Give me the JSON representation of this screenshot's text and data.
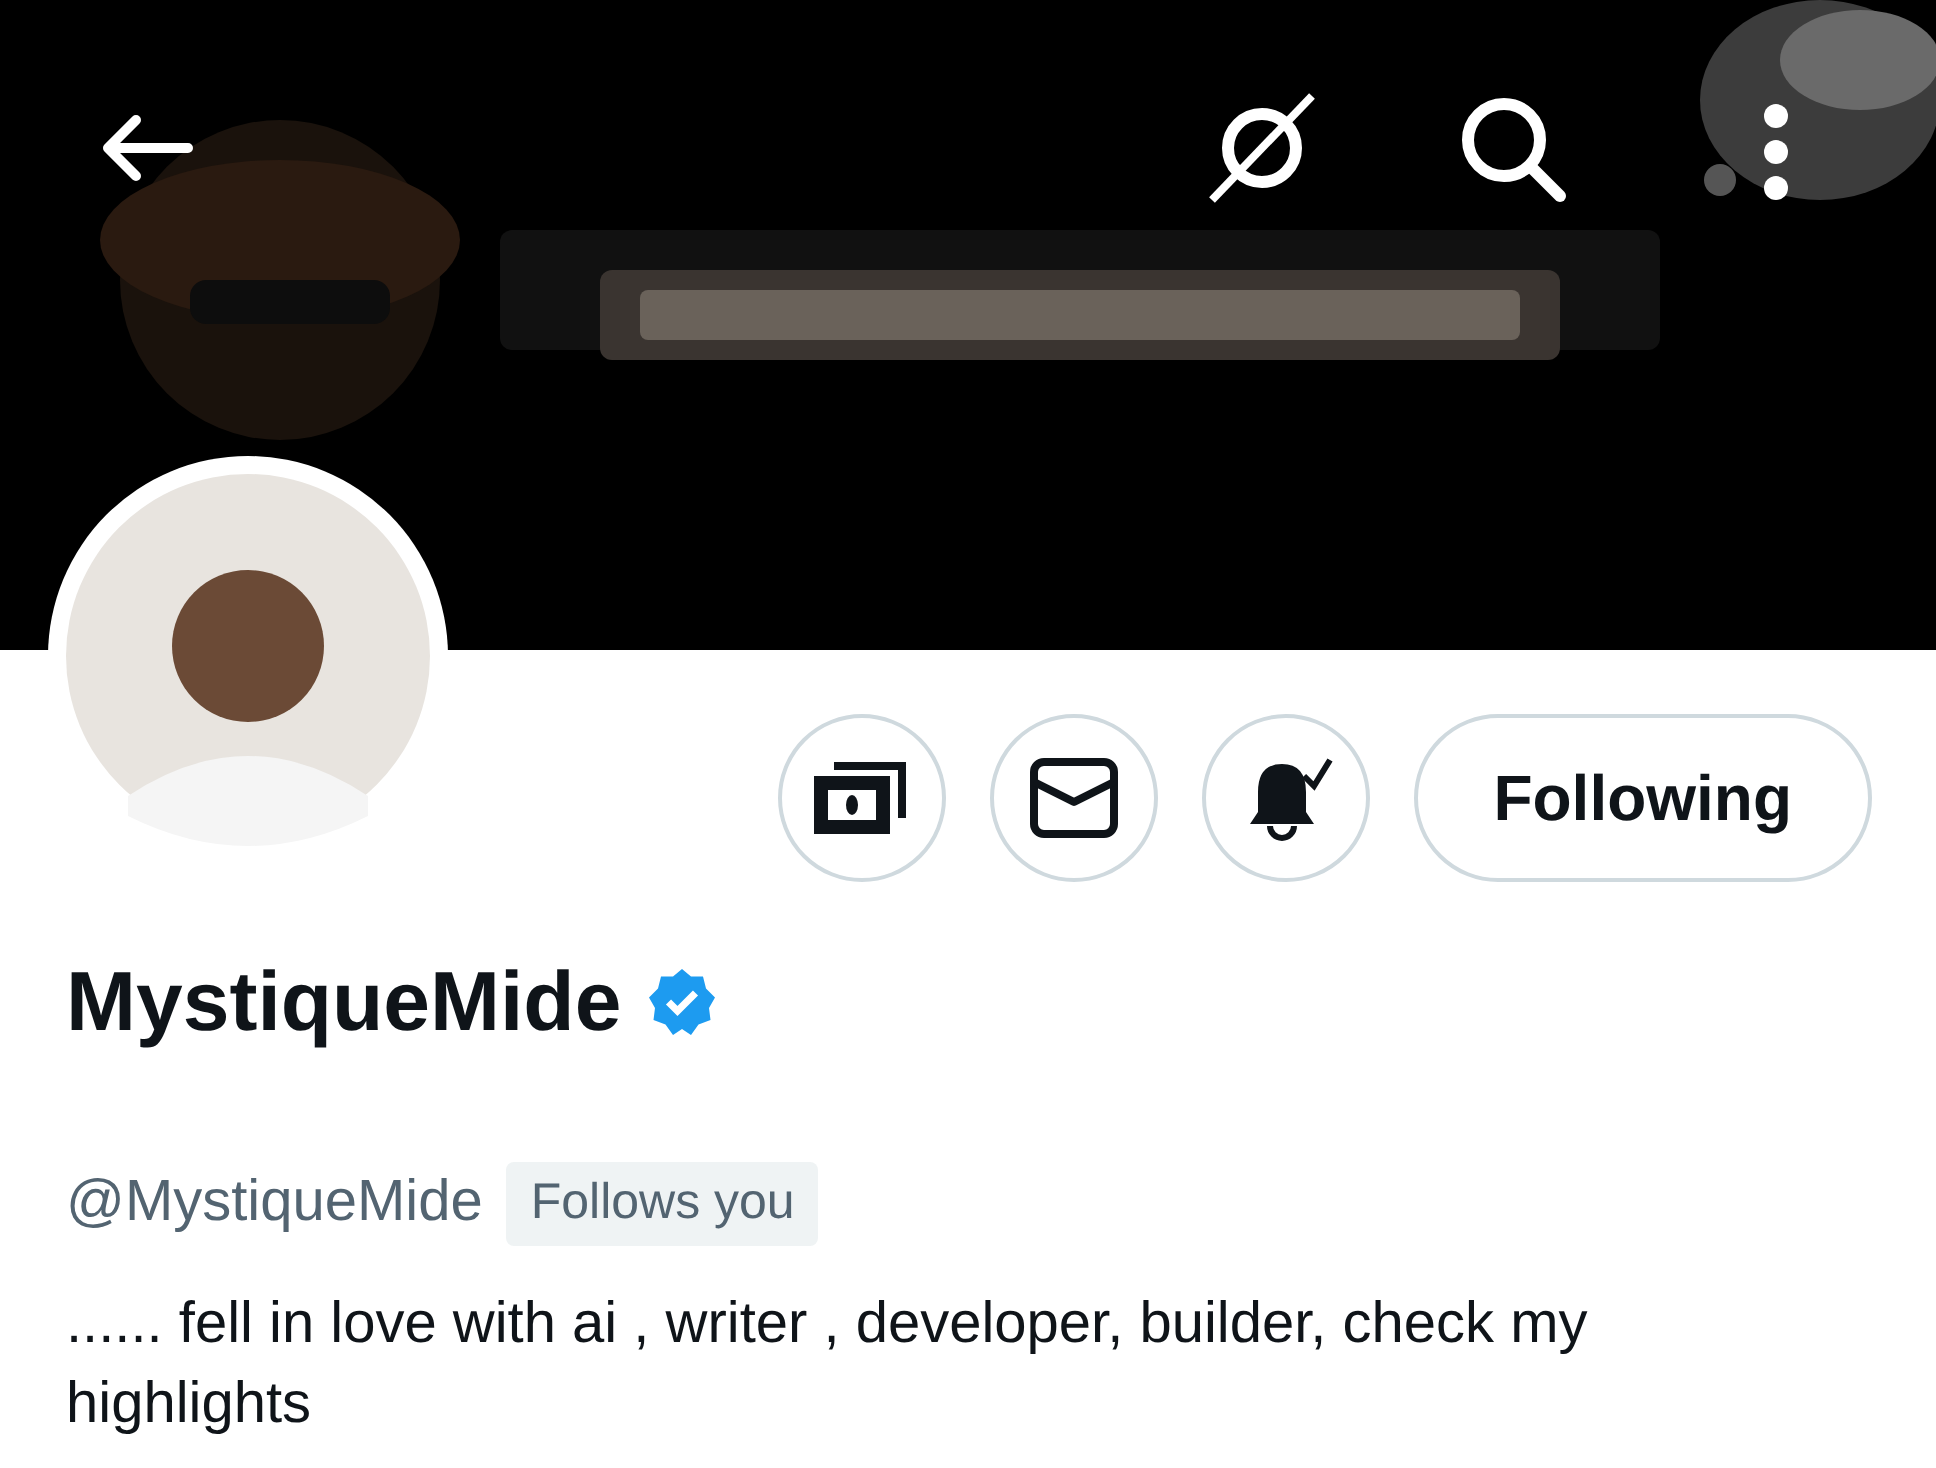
{
  "profile": {
    "name": "MystiqueMide",
    "verified": true,
    "handle": "@MystiqueMide",
    "follows_you_badge": "Follows you",
    "bio": "...... fell in love with ai , writer , developer, builder, check my highlights"
  },
  "follow_button": {
    "label": "Following"
  }
}
